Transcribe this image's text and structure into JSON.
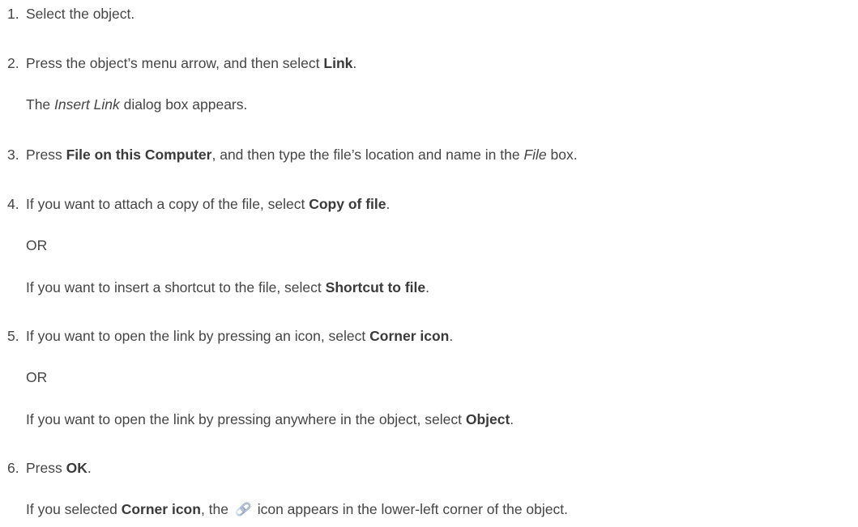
{
  "steps": [
    {
      "number": "1.",
      "text": "Select the object."
    },
    {
      "number": "2.",
      "pre": "Press the object’s menu arrow, and then select ",
      "bold": "Link",
      "post": ".",
      "note": {
        "pre": "The ",
        "italic": "Insert Link",
        "post": " dialog box appears."
      }
    },
    {
      "number": "3.",
      "pre": "Press ",
      "bold": "File on this Computer",
      "mid": ", and then type the file’s location and name in the ",
      "italic": "File",
      "post": " box."
    },
    {
      "number": "4.",
      "pre": "If you want to attach a copy of the file, select ",
      "bold": "Copy of file",
      "post": ".",
      "or": "OR",
      "alt": {
        "pre": "If you want to insert a shortcut to the file, select ",
        "bold": "Shortcut to file",
        "post": "."
      }
    },
    {
      "number": "5.",
      "pre": "If you want to open the link by pressing an icon, select ",
      "bold": "Corner icon",
      "post": ".",
      "or": "OR",
      "alt": {
        "pre": "If you want to open the link by pressing anywhere in the object, select ",
        "bold": "Object",
        "post": "."
      }
    },
    {
      "number": "6.",
      "pre": "Press ",
      "bold": "OK",
      "post": ".",
      "note": {
        "pre": "If you selected ",
        "bold": "Corner icon",
        "mid": ", the ",
        "icon": "link-icon",
        "post": " icon appears in the lower-left corner of the object."
      }
    }
  ]
}
